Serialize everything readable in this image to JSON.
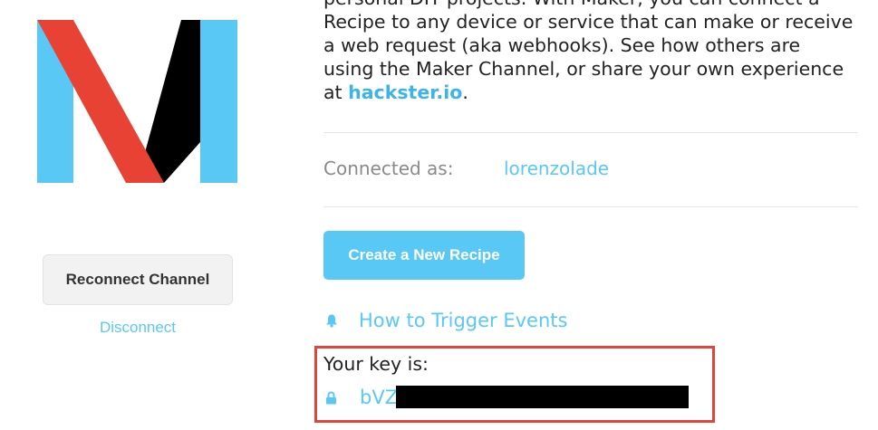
{
  "brand": {
    "logo": "maker-channel-logo",
    "colors": {
      "red": "#e84234",
      "blue": "#5ac8f5",
      "black": "#000000"
    }
  },
  "left_panel": {
    "reconnect_label": "Reconnect Channel",
    "disconnect_label": "Disconnect"
  },
  "description": {
    "lines": [
      "personal DIY projects. With Maker, you can connect a",
      "Recipe to any device or service that can make or receive",
      "a web request (aka webhooks). See how others are",
      "using the Maker Channel, or share your own experience"
    ],
    "last_prefix": "at ",
    "link_text": "hackster.io",
    "last_suffix": "."
  },
  "account": {
    "connected_label": "Connected as:",
    "username": "lorenzolade"
  },
  "actions": {
    "create_recipe_label": "Create a New Recipe",
    "trigger_events_label": "How to Trigger Events",
    "trigger_icon": "bell-icon"
  },
  "key": {
    "label": "Your key is:",
    "visible_value": "bVZ",
    "lock_icon": "lock-icon",
    "highlight_color": "#e0473a"
  }
}
